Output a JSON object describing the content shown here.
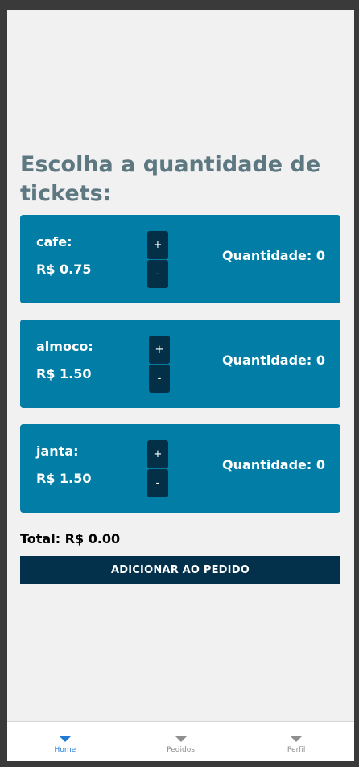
{
  "heading": "Escolha a quantidade de tickets:",
  "items": [
    {
      "name": "cafe:",
      "price": "R$ 0.75",
      "quantity": "Quantidade: 0",
      "plus": "+",
      "minus": "-"
    },
    {
      "name": "almoco:",
      "price": "R$ 1.50",
      "quantity": "Quantidade: 0",
      "plus": "+",
      "minus": "-"
    },
    {
      "name": "janta:",
      "price": "R$ 1.50",
      "quantity": "Quantidade: 0",
      "plus": "+",
      "minus": "-"
    }
  ],
  "total": "Total: R$ 0.00",
  "add_button": "ADICIONAR AO PEDIDO",
  "tabs": [
    {
      "label": "Home",
      "icon": "triangle-down-icon",
      "active": true
    },
    {
      "label": "Pedidos",
      "icon": "triangle-down-icon",
      "active": false
    },
    {
      "label": "Perfil",
      "icon": "triangle-down-icon",
      "active": false
    }
  ],
  "colors": {
    "card": "#017da6",
    "button_dark": "#03304a",
    "heading": "#5d7880",
    "tab_active": "#1f7ad6",
    "tab_inactive": "#8e8e8e"
  }
}
